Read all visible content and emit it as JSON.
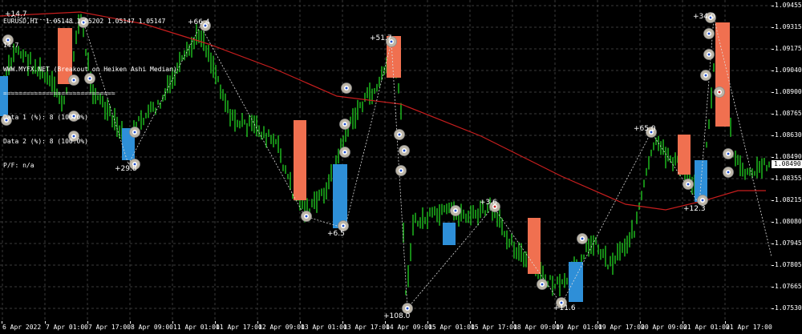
{
  "info": {
    "symbol_line": "EURUSD,H1  1.05148 1.05202 1.05147 1.05147",
    "lines": [
      "14.7",
      "WWW.MYFX.NET (Breakout on Heiken Ashi Median)",
      "=============================",
      "Data 1 (%): 8 (100.0%)",
      "Data 2 (%): 8 (100.0%)",
      "P/F: n/a"
    ]
  },
  "price_axis": {
    "ticks": [
      "1.09455",
      "1.09315",
      "1.09175",
      "1.09040",
      "1.08900",
      "1.08765",
      "1.08630",
      "1.08490",
      "1.08355",
      "1.08215",
      "1.08080",
      "1.07945",
      "1.07805",
      "1.07665",
      "1.07530"
    ],
    "current": "1.08490"
  },
  "time_axis": {
    "ticks": [
      "6 Apr 2022",
      "7 Apr 01:00",
      "7 Apr 17:00",
      "8 Apr 09:00",
      "11 Apr 01:00",
      "11 Apr 17:00",
      "12 Apr 09:00",
      "13 Apr 01:00",
      "13 Apr 17:00",
      "14 Apr 09:00",
      "15 Apr 01:00",
      "15 Apr 17:00",
      "18 Apr 09:00",
      "19 Apr 01:00",
      "19 Apr 17:00",
      "20 Apr 09:00",
      "21 Apr 01:00",
      "21 Apr 17:00"
    ]
  },
  "trade_labels": [
    "+14.7",
    "+66.4",
    "+29.8",
    "+51.7",
    "+6.5",
    "+108.0",
    "+3.6",
    "+11.6",
    "+65.0",
    "+34.0",
    "+12.3"
  ],
  "colors": {
    "background": "#000000",
    "grid": "#3a3a3a",
    "bull": "#1fc41f",
    "ma": "#c81e1e",
    "box_up": "#2e8fd8",
    "box_down": "#f07050",
    "text": "#ffffff"
  },
  "icons": {
    "trade_marker": "trade-marker-icon"
  }
}
